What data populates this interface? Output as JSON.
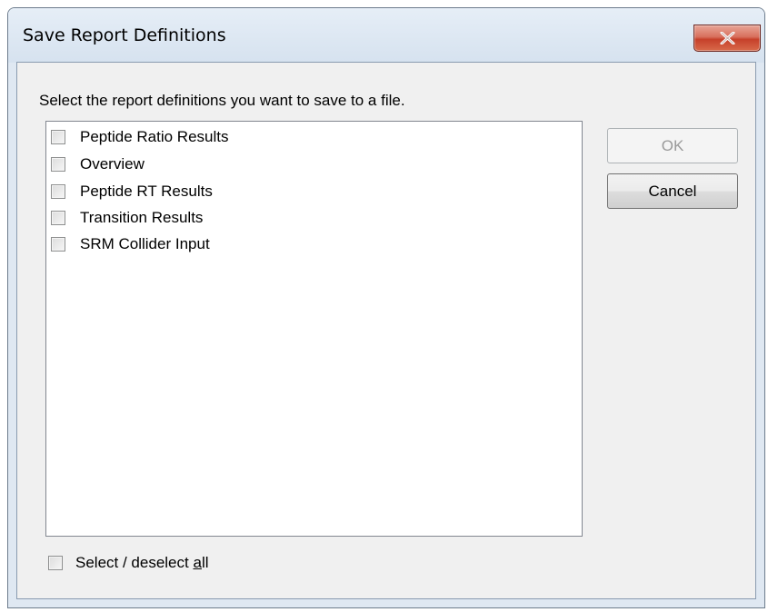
{
  "dialog": {
    "title": "Save Report Definitions",
    "instruction": "Select the report definitions you want to save to a file.",
    "items": [
      {
        "label": "Peptide Ratio Results",
        "checked": false
      },
      {
        "label": "Overview",
        "checked": false
      },
      {
        "label": "Peptide RT Results",
        "checked": false
      },
      {
        "label": "Transition Results",
        "checked": false
      },
      {
        "label": "SRM Collider Input",
        "checked": false
      }
    ],
    "select_all": {
      "prefix": "Select / deselect ",
      "mnemonic": "a",
      "suffix": "ll",
      "checked": false
    },
    "ok_label": "OK",
    "ok_enabled": false,
    "cancel_label": "Cancel"
  },
  "icons": {
    "close": "close-x-icon"
  },
  "colors": {
    "close_button": "#c6402a",
    "window_frame": "#dfe8f2",
    "client_background": "#f0f0f0"
  }
}
